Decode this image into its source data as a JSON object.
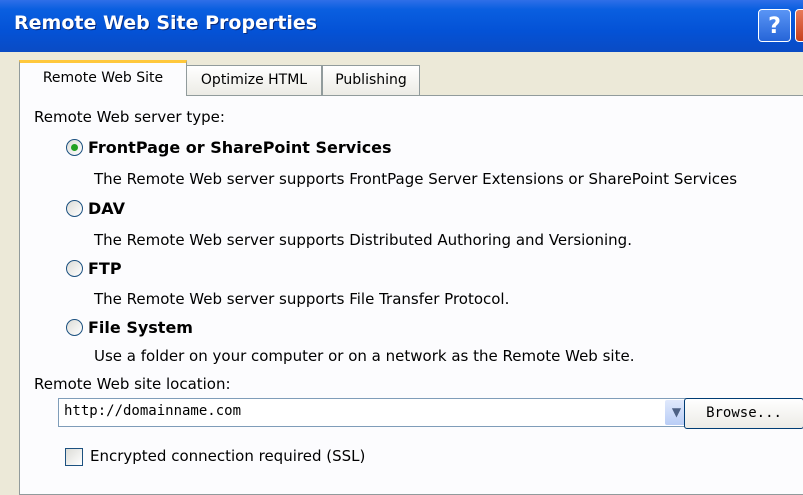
{
  "window": {
    "title": "Remote Web Site Properties",
    "help_label": "?"
  },
  "tabs": [
    {
      "label": "Remote Web Site",
      "active": true
    },
    {
      "label": "Optimize HTML",
      "active": false
    },
    {
      "label": "Publishing",
      "active": false
    }
  ],
  "server_type": {
    "heading": "Remote Web server type:",
    "options": [
      {
        "label": "FrontPage or SharePoint Services",
        "description": "The Remote Web server supports FrontPage Server Extensions or SharePoint Services",
        "selected": true
      },
      {
        "label": "DAV",
        "description": "The Remote Web server supports Distributed Authoring and Versioning.",
        "selected": false
      },
      {
        "label": "FTP",
        "description": "The Remote Web server supports File Transfer Protocol.",
        "selected": false
      },
      {
        "label": "File System",
        "description": "Use a folder on your computer or on a network as the Remote Web site.",
        "selected": false
      }
    ]
  },
  "location": {
    "label": "Remote Web site location:",
    "value": "http://domainname.com",
    "browse_label": "Browse..."
  },
  "ssl": {
    "label": "Encrypted connection required (SSL)",
    "checked": false
  },
  "colors": {
    "title_bar": "#0452d6",
    "dialog_bg": "#ece9d8",
    "active_tab_accent": "#ffc83c",
    "radio_selected": "#21a121"
  }
}
